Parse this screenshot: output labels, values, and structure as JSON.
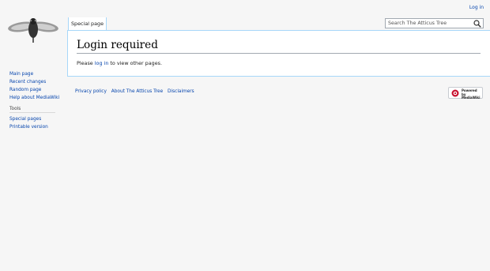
{
  "personal": {
    "login_link": "Log in"
  },
  "tabs": {
    "special_page": "Special page"
  },
  "search": {
    "placeholder": "Search The Atticus Tree"
  },
  "page": {
    "title": "Login required",
    "message_before": "Please ",
    "message_link": "log in",
    "message_after": " to view other pages."
  },
  "sidebar": {
    "navigation": [
      "Main page",
      "Recent changes",
      "Random page",
      "Help about MediaWiki"
    ],
    "tools_heading": "Tools",
    "tools": [
      "Special pages",
      "Printable version"
    ]
  },
  "footer": {
    "links": [
      "Privacy policy",
      "About The Atticus Tree",
      "Disclaimers"
    ],
    "powered_by_line1": "Powered by",
    "powered_by_line2": "MediaWiki"
  },
  "icons": {
    "logo": "cicada-logo",
    "search": "search-icon",
    "powered": "mediawiki-icon"
  }
}
